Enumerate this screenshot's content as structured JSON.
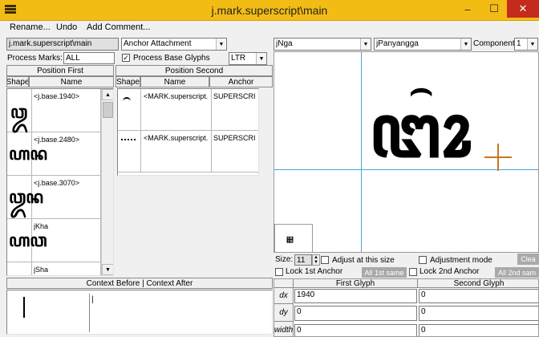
{
  "window": {
    "title": "j.mark.superscript\\main"
  },
  "menu": {
    "rename": "Rename...",
    "undo": "Undo",
    "add_comment": "Add Comment..."
  },
  "left": {
    "lookup_name": "j.mark.superscript\\main",
    "lookup_type": "Anchor Attachment",
    "process_marks_label": "Process Marks:",
    "process_marks_value": "ALL",
    "process_base_label": "Process Base Glyphs",
    "direction": "LTR",
    "position_first": "Position First",
    "col_shape": "Shape",
    "col_name": "Name",
    "rows": [
      {
        "name": "<j.base.1940>",
        "glyph": "ꦎ"
      },
      {
        "name": "<j.base.2480>",
        "glyph": "ꦲꦤ"
      },
      {
        "name": "<j.base.3070>",
        "glyph": "ꦎꦤ"
      },
      {
        "name": "jKha",
        "glyph": "ꦲꦮ"
      },
      {
        "name": "jSha",
        "glyph": ""
      }
    ],
    "context_header": "Context Before | Context After",
    "context_value": "|"
  },
  "second": {
    "header": "Position Second",
    "col_shape": "Shape",
    "col_name": "Name",
    "col_anchor": "Anchor",
    "rows": [
      {
        "name": "<MARK.superscript.",
        "anchor": "SUPERSCRI"
      },
      {
        "name": "<MARK.superscript.",
        "anchor": "SUPERSCRI"
      }
    ]
  },
  "preview": {
    "glyph1": "jNga",
    "glyph2": "jPanyangga",
    "component_label": "Component:",
    "component_value": "1",
    "main_glyph": "ꦔꦴ",
    "size_label": "Size:",
    "size_value": "11",
    "adjust_size_label": "Adjust at this size",
    "adjust_mode_label": "Adjustment mode",
    "clear_label": "Clea",
    "lock1_label": "Lock 1st Anchor",
    "all1_label": "All 1st same",
    "lock2_label": "Lock 2nd Anchor",
    "all2_label": "All 2nd sam",
    "first_glyph": "First Glyph",
    "second_glyph": "Second Glyph",
    "dx_label": "dx",
    "dy_label": "dy",
    "width_label": "width",
    "dx1": "1940",
    "dx2": "0",
    "dy1": "0",
    "dy2": "0",
    "w1": "0",
    "w2": "0"
  },
  "colors": {
    "title_bar": "#f3bc14",
    "close_button": "#c42b1c",
    "guide_line": "#4aa3df",
    "anchor_marker": "#c8781e"
  }
}
